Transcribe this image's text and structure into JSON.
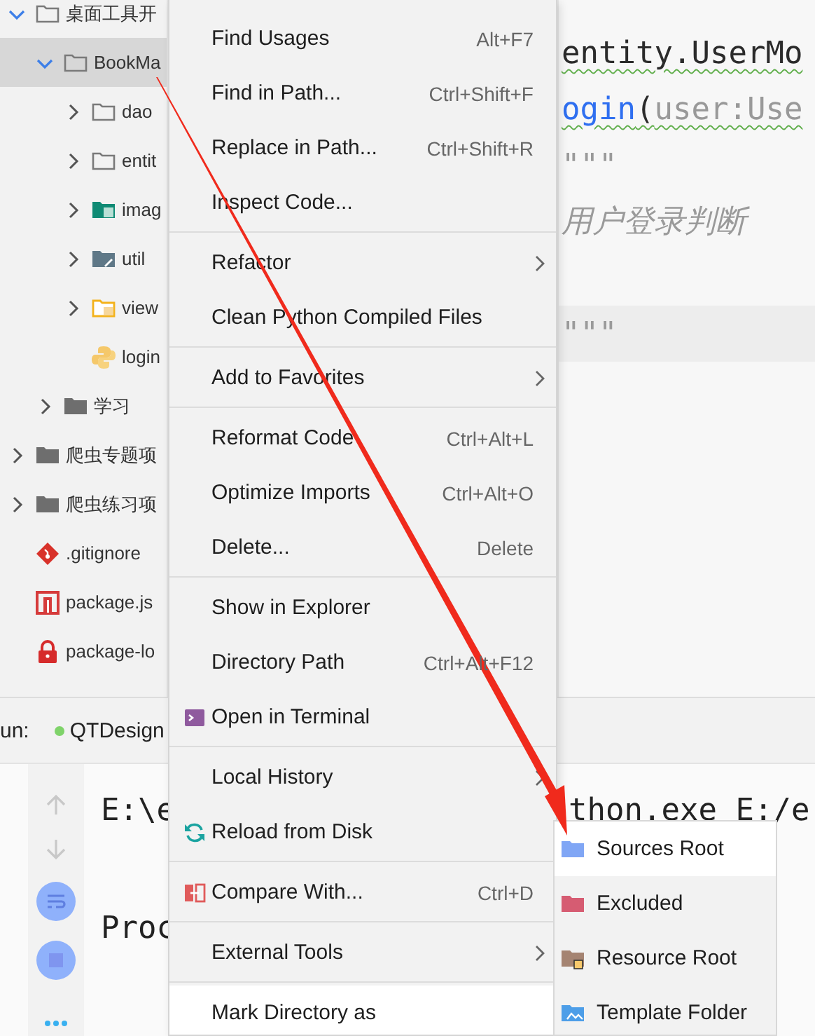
{
  "project_tree": [
    {
      "label": "桌面工具开",
      "kind": "folder",
      "expanded": true,
      "selected": false,
      "children": [
        {
          "label": "BookMa",
          "kind": "folder",
          "expanded": true,
          "selected": true,
          "children": [
            {
              "label": "dao",
              "kind": "folder",
              "expanded": false,
              "selected": false
            },
            {
              "label": "entit",
              "kind": "folder",
              "expanded": false,
              "selected": false
            },
            {
              "label": "imag",
              "kind": "resources",
              "expanded": false,
              "selected": false
            },
            {
              "label": "util",
              "kind": "package",
              "expanded": false,
              "selected": false
            },
            {
              "label": "view",
              "kind": "views",
              "expanded": false,
              "selected": false
            },
            {
              "label": "login",
              "kind": "python",
              "selected": false
            }
          ]
        },
        {
          "label": "学习",
          "kind": "solid",
          "expanded": false,
          "selected": false
        }
      ]
    },
    {
      "label": "爬虫专题项",
      "kind": "solid",
      "expanded": false,
      "selected": false
    },
    {
      "label": "爬虫练习项",
      "kind": "solid",
      "expanded": false,
      "selected": false
    },
    {
      "label": ".gitignore",
      "kind": "git",
      "selected": false
    },
    {
      "label": "package.js",
      "kind": "npm",
      "selected": false
    },
    {
      "label": "package-lo",
      "kind": "lock",
      "selected": false
    }
  ],
  "editor": {
    "lines": [
      {
        "current": false,
        "tokens": [
          {
            "text": "entity.UserMo",
            "kind": "plain",
            "warning": true
          }
        ]
      },
      {
        "current": false,
        "tokens": [
          {
            "text": "ogin",
            "kind": "function",
            "warning": true
          },
          {
            "text": "(",
            "kind": "plain",
            "warning": true
          },
          {
            "text": "user:Use",
            "kind": "param",
            "warning": true
          }
        ]
      },
      {
        "current": false,
        "tokens": [
          {
            "text": "\"\"\"",
            "kind": "doc",
            "warning": false
          }
        ]
      },
      {
        "current": false,
        "tokens": [
          {
            "text": "用户登录判断",
            "kind": "doc",
            "warning": false
          }
        ]
      },
      {
        "current": true,
        "tokens": [
          {
            "text": "\"\"\"",
            "kind": "doc",
            "warning": false
          }
        ]
      }
    ]
  },
  "run_panel": {
    "label": "un:",
    "configuration": "QTDesign",
    "console_lines": [
      {
        "left": "E:\\e",
        "right": "thon.exe E:/e"
      },
      {
        "left": "Proc"
      }
    ]
  },
  "context_menu": {
    "groups": [
      [
        {
          "label": "Find Usages",
          "shortcut": "Alt+F7",
          "submenu": false,
          "selected": false
        },
        {
          "label": "Find in Path...",
          "shortcut": "Ctrl+Shift+F",
          "submenu": false,
          "selected": false
        },
        {
          "label": "Replace in Path...",
          "shortcut": "Ctrl+Shift+R",
          "submenu": false,
          "selected": false
        },
        {
          "label": "Inspect Code...",
          "submenu": false,
          "selected": false
        }
      ],
      [
        {
          "label": "Refactor",
          "submenu": true,
          "selected": false
        },
        {
          "label": "Clean Python Compiled Files",
          "submenu": false,
          "selected": false
        }
      ],
      [
        {
          "label": "Add to Favorites",
          "submenu": true,
          "selected": false
        }
      ],
      [
        {
          "label": "Reformat Code",
          "shortcut": "Ctrl+Alt+L",
          "submenu": false,
          "selected": false
        },
        {
          "label": "Optimize Imports",
          "shortcut": "Ctrl+Alt+O",
          "submenu": false,
          "selected": false
        },
        {
          "label": "Delete...",
          "shortcut": "Delete",
          "submenu": false,
          "selected": false
        }
      ],
      [
        {
          "label": "Show in Explorer",
          "submenu": false,
          "selected": false
        },
        {
          "label": "Directory Path",
          "shortcut": "Ctrl+Alt+F12",
          "submenu": false,
          "selected": false
        },
        {
          "label": "Open in Terminal",
          "kind": "terminal",
          "submenu": false,
          "selected": false
        }
      ],
      [
        {
          "label": "Local History",
          "submenu": true,
          "selected": false
        },
        {
          "label": "Reload from Disk",
          "kind": "reload",
          "submenu": false,
          "selected": false
        }
      ],
      [
        {
          "label": "Compare With...",
          "kind": "compare",
          "shortcut": "Ctrl+D",
          "submenu": false,
          "selected": false
        }
      ],
      [
        {
          "label": "External Tools",
          "submenu": true,
          "selected": false
        }
      ],
      [
        {
          "label": "Mark Directory as",
          "submenu": false,
          "selected": true
        }
      ]
    ]
  },
  "submenu": {
    "items": [
      {
        "label": "Sources Root",
        "kind": "sources",
        "selected": true
      },
      {
        "label": "Excluded",
        "kind": "excluded",
        "selected": false
      },
      {
        "label": "Resource Root",
        "kind": "resource",
        "selected": false
      },
      {
        "label": "Template Folder",
        "kind": "template",
        "selected": false
      }
    ]
  }
}
